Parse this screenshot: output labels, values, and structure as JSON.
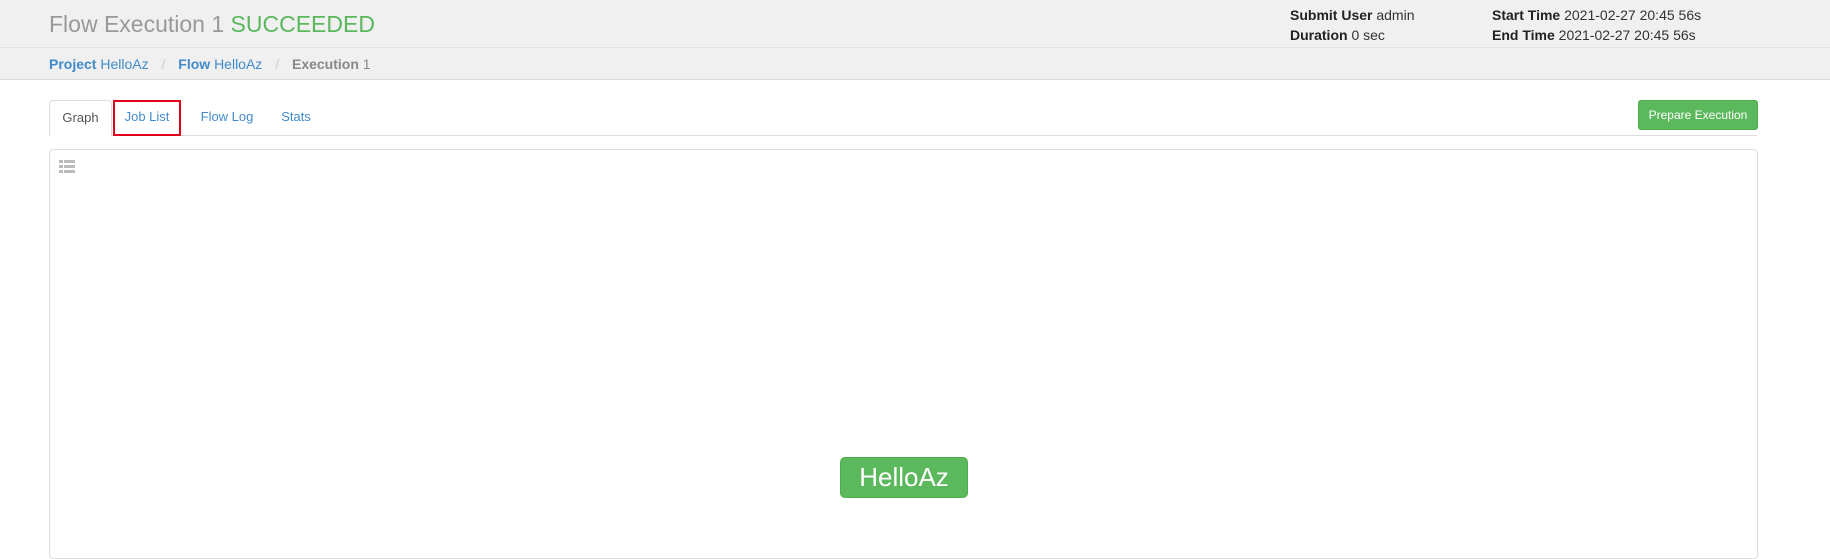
{
  "header": {
    "title": "Flow Execution 1",
    "status": "SUCCEEDED",
    "status_color": "#5cb85c",
    "submit_user_label": "Submit User",
    "submit_user": "admin",
    "duration_label": "Duration",
    "duration": "0 sec",
    "start_time_label": "Start Time",
    "start_time": "2021-02-27 20:45 56s",
    "end_time_label": "End Time",
    "end_time": "2021-02-27 20:45 56s"
  },
  "breadcrumb": {
    "project_label": "Project",
    "project_value": "HelloAz",
    "flow_label": "Flow",
    "flow_value": "HelloAz",
    "execution_label": "Execution",
    "execution_value": "1",
    "separator": "/"
  },
  "tabs": [
    {
      "label": "Graph",
      "active": true
    },
    {
      "label": "Job List",
      "active": false,
      "highlighted": true
    },
    {
      "label": "Flow Log",
      "active": false
    },
    {
      "label": "Stats",
      "active": false
    }
  ],
  "actions": {
    "prepare_execution_label": "Prepare Execution"
  },
  "graph": {
    "toggle_icon": "list-icon",
    "nodes": [
      {
        "label": "HelloAz",
        "status": "succeeded",
        "color": "#5cb85c"
      }
    ]
  }
}
